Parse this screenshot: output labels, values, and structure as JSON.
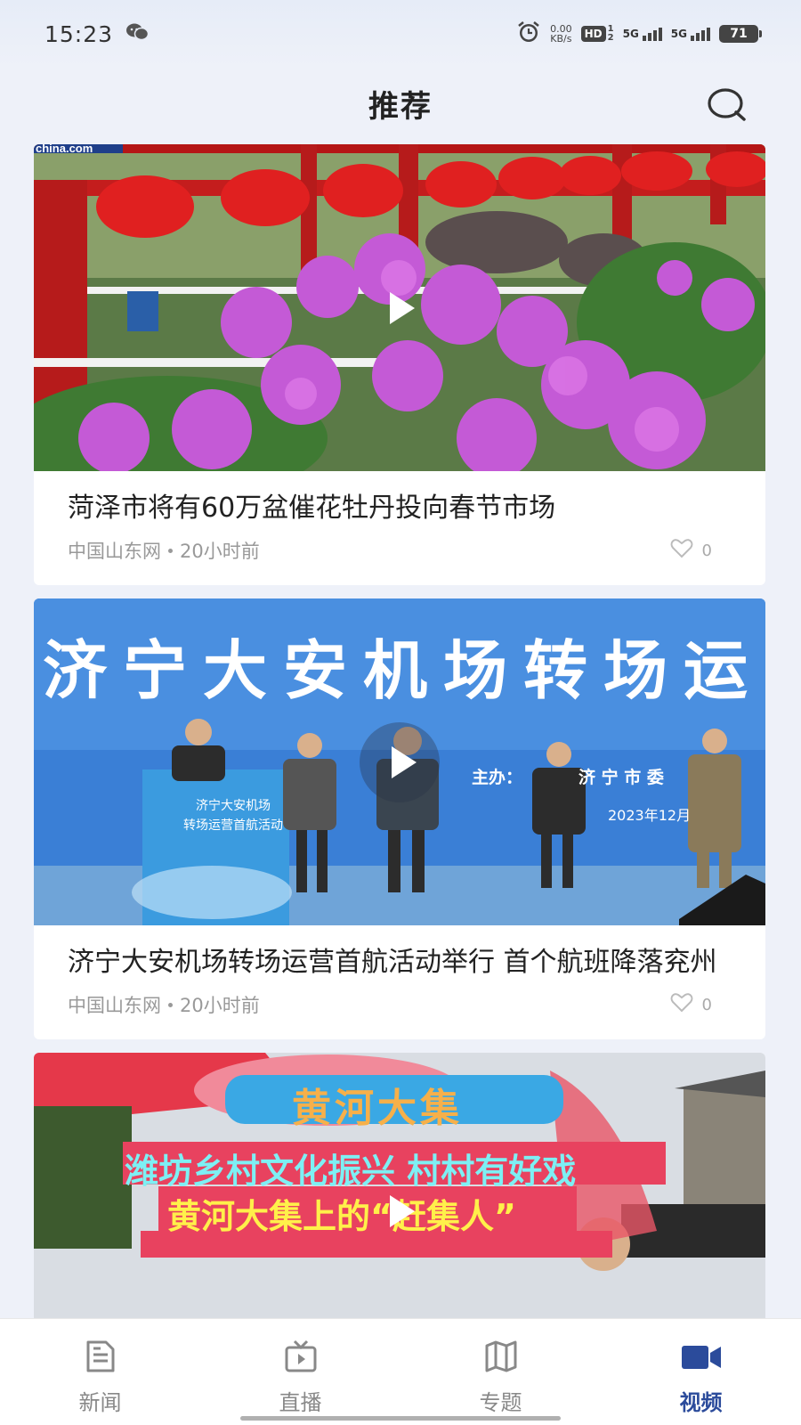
{
  "status": {
    "time": "15:23",
    "net_speed_value": "0.00",
    "net_speed_unit": "KB/s",
    "hd": "HD",
    "hd_sub_top": "1",
    "hd_sub_bottom": "2",
    "signal1": "5G",
    "signal2": "5G",
    "battery": "71",
    "icons": [
      "wechat-icon",
      "alarm-icon",
      "hd-icon",
      "signal-icon",
      "battery-icon"
    ]
  },
  "header": {
    "title": "推荐",
    "search_icon": "search-icon"
  },
  "feed": [
    {
      "title": "菏泽市将有60万盆催花牡丹投向春节市场",
      "source": "中国山东网",
      "time": "20小时前",
      "likes": "0",
      "thumb_text": "china.com"
    },
    {
      "title": "济宁大安机场转场运营首航活动举行 首个航班降落兖州",
      "source": "中国山东网",
      "time": "20小时前",
      "likes": "0",
      "thumb_banner": "济宁大安机场转场运",
      "thumb_host_label": "主办：",
      "thumb_host": "济 宁 市 委",
      "thumb_date": "2023年12月",
      "thumb_podium_line1": "济宁大安机场",
      "thumb_podium_line2": "转场运营首航活动"
    },
    {
      "thumb_title": "黄河大集",
      "thumb_line1": "潍坊乡村文化振兴 村村有好戏",
      "thumb_line2": "黄河大集上的“赶集人”"
    }
  ],
  "tabbar": {
    "tabs": [
      {
        "label": "新闻",
        "icon": "document-icon",
        "active": false
      },
      {
        "label": "直播",
        "icon": "tv-icon",
        "active": false
      },
      {
        "label": "专题",
        "icon": "map-icon",
        "active": false
      },
      {
        "label": "视频",
        "icon": "video-camera-icon",
        "active": true
      }
    ]
  },
  "colors": {
    "accent": "#2b4b9b",
    "background": "#eef1f9",
    "meta_text": "#999999"
  }
}
